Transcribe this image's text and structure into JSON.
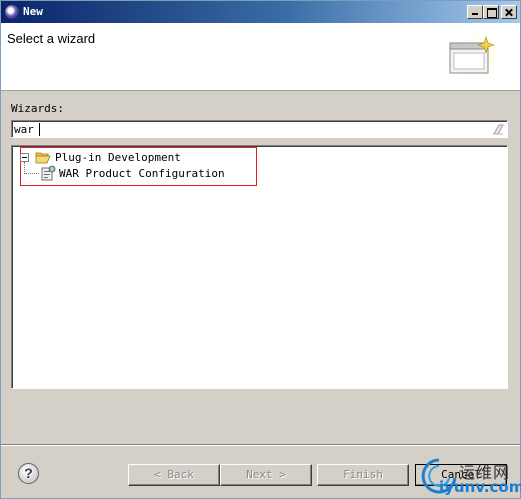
{
  "window": {
    "title": "New"
  },
  "banner": {
    "title": "Select a wizard",
    "icon": "new-wizard-icon"
  },
  "wizards": {
    "label": "Wizards:",
    "filter_value": "war",
    "tree": [
      {
        "label": "Plug-in Development",
        "expanded": true,
        "icon": "folder-open-icon",
        "children": [
          {
            "label": "WAR Product Configuration",
            "icon": "product-configuration-icon"
          }
        ]
      }
    ],
    "highlight_color": "#e02020"
  },
  "buttons": {
    "help": "?",
    "back": "< Back",
    "next": "Next >",
    "finish": "Finish",
    "cancel": "Cancel"
  },
  "watermark": {
    "chinese": "运维网",
    "url": "iyunv.com"
  },
  "colors": {
    "titlebar_start": "#0a246a",
    "titlebar_end": "#a6caf0",
    "dialog_bg": "#d4d0c8"
  }
}
